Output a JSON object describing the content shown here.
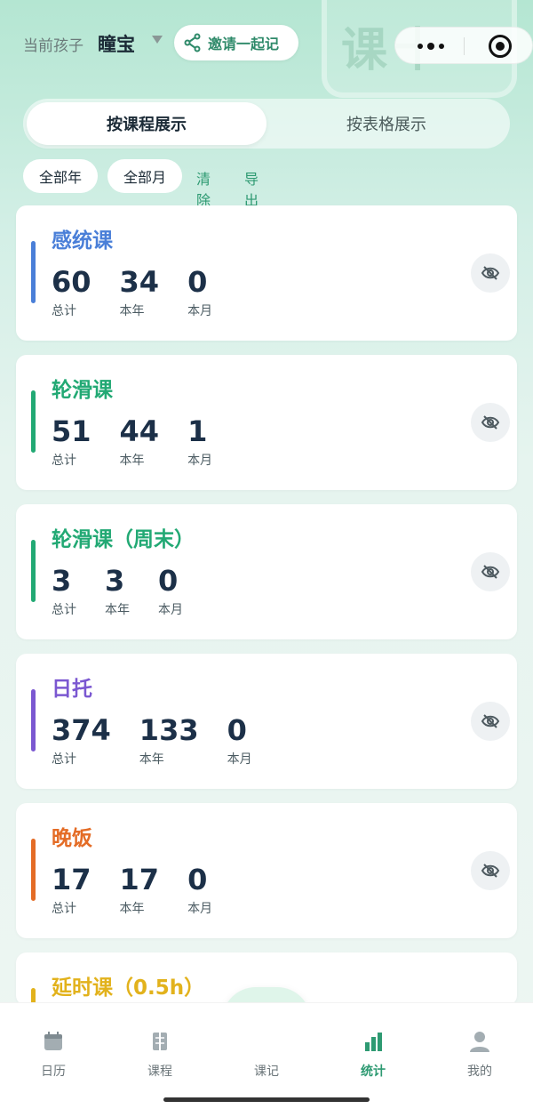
{
  "header": {
    "child_label": "当前孩子",
    "child_name": "瞳宝",
    "invite_label": "邀请一起记",
    "watermark": "课十"
  },
  "view_switch": {
    "active": "按课程展示",
    "inactive": "按表格展示"
  },
  "filters": {
    "year": "全部年",
    "month": "全部月",
    "clear": "清除",
    "export": "导出"
  },
  "cards": [
    {
      "title": "感统课",
      "color": "#4a7fd8",
      "stats": [
        {
          "value": "60",
          "label": "总计"
        },
        {
          "value": "34",
          "label": "本年"
        },
        {
          "value": "0",
          "label": "本月"
        }
      ]
    },
    {
      "title": "轮滑课",
      "color": "#22a974",
      "stats": [
        {
          "value": "51",
          "label": "总计"
        },
        {
          "value": "44",
          "label": "本年"
        },
        {
          "value": "1",
          "label": "本月"
        }
      ]
    },
    {
      "title": "轮滑课（周末）",
      "color": "#22a974",
      "stats": [
        {
          "value": "3",
          "label": "总计"
        },
        {
          "value": "3",
          "label": "本年"
        },
        {
          "value": "0",
          "label": "本月"
        }
      ]
    },
    {
      "title": "日托",
      "color": "#7b58d1",
      "stats": [
        {
          "value": "374",
          "label": "总计"
        },
        {
          "value": "133",
          "label": "本年"
        },
        {
          "value": "0",
          "label": "本月"
        }
      ]
    },
    {
      "title": "晚饭",
      "color": "#e46c26",
      "stats": [
        {
          "value": "17",
          "label": "总计"
        },
        {
          "value": "17",
          "label": "本年"
        },
        {
          "value": "0",
          "label": "本月"
        }
      ]
    },
    {
      "title": "延时课（0.5h）",
      "color": "#e2b21c"
    }
  ],
  "tabbar": {
    "calendar": "日历",
    "courses": "课程",
    "record": "课记",
    "stats": "统计",
    "mine": "我的",
    "active_color": "#2e9a72"
  }
}
